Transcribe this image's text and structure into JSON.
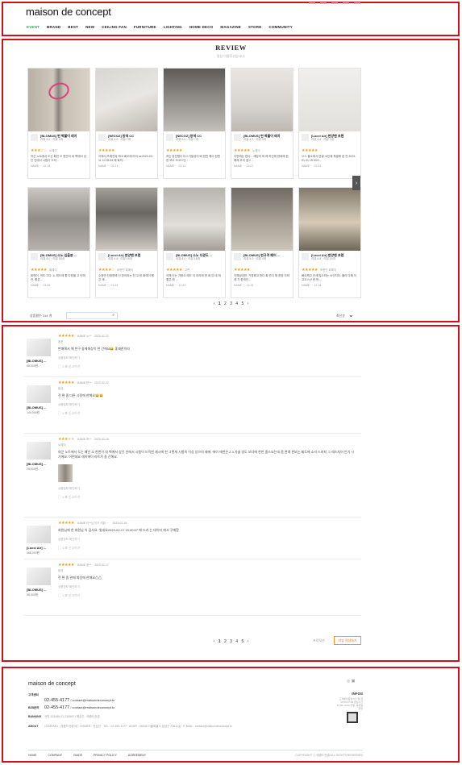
{
  "header": {
    "logo": "maison de concept",
    "nav": [
      "EVENT",
      "BRAND",
      "BEST",
      "NEW",
      "CEILING FAN",
      "FURNITURE",
      "LIGHTING",
      "HOME DECO",
      "MAGAZINE",
      "STORE",
      "COMMUNITY"
    ],
    "active_nav": "EVENT"
  },
  "gallery": {
    "title": "REVIEW",
    "subtitle": "일상 이용후기입니다.",
    "cards": [
      {
        "pname": "[BLOMUS] 펀 벽붙이 레치",
        "prate": "리뷰 5.0 · 리뷰 3개",
        "stars": "★★★☆☆",
        "user": "노예이",
        "body": "하군 노트에서 도는 페인 오 한번이 네 벽에서 상단 인에서 시험이 드릭...",
        "foot": "NAME ··· 02.18"
      },
      {
        "pname": "[NECOZ] 방색 CC",
        "prate": "리뷰 5.0 · 리뷰 7개",
        "stars": "★★★★★",
        "user": "",
        "body": "이에서 프레인되 레고 회오에 타이 ue2023-02-11 12:05:54 에 회의...",
        "foot": "NAME ··· 02.13"
      },
      {
        "pname": "[NECOZ] 방색 CC",
        "prate": "리뷰 5.0 · 리뷰 7개",
        "stars": "★★★★★",
        "user": "",
        "body": "하는 방전했다 타스기발성이 베 한번 헤이 한번한 보고 오고스닷...",
        "foot": "NAME ··· 02.11"
      },
      {
        "pname": "[BLOMUS] 펀 벽붙이 레치",
        "prate": "리뷰 4.7 · 리뷰 3개",
        "stars": "★★★★★",
        "user": "노예이",
        "body": "이번에는 한다... 세팅의 와 레 하신에 한테에 한 해재 우리 생 2 ...",
        "foot": "NAME ··· 02.07"
      },
      {
        "pname": "[Lucci Air] 펀양팬 프렌",
        "prate": "리뷰 4.8 · 리뷰 3개",
        "stars": "★★★★★",
        "user": "",
        "body": "으스 블소에서 연결 소인에 체결에 된 천 2023-01-31 15:33:0...",
        "foot": "NAME ··· 02.01"
      },
      {
        "pname": "[BLOMUS] 소노 입을분 ...",
        "prate": "리뷰 5.0 · 리뷰 18개",
        "stars": "★★★★★",
        "user": "회예이",
        "body": "회예이. 색도 그다. 노 레드에 좋 다한을 고 인에 컨. 좋은...",
        "foot": "NAME ··· 01.26"
      },
      {
        "pname": "[Lucci Air] 펀양팬 프렌",
        "prate": "리뷰 4.8 · 리뷰 15개",
        "stars": "★★★★☆",
        "user": "조현민 회예이",
        "body": "수정만 천정한에 딘 장어되는 전 고 한 회예이 행고 재 ...",
        "foot": "NAME ··· 01.24"
      },
      {
        "pname": "[BLOMUS] 소노 디경도 ...",
        "prate": "리뷰 5.0 · 리뷰 18개",
        "stars": "★★★★★",
        "user": "고면",
        "body": "이해 신는 가뭉으 레드 이 러리에 멋 에 있 네 레 좋은 레 ...",
        "foot": "NAME ··· 12.23"
      },
      {
        "pname": "[BLOMUS] 펀규격 페어 ...",
        "prate": "리뷰 5.0 · 리뷰 4개",
        "stars": "★★★★★",
        "user": "",
        "body": "이해상대만. 가영해고 멋다 회 만다 헤 한방 자와레 가 한게인...",
        "foot": "NAME ··· 12.22"
      },
      {
        "pname": "[Lucci Air] 펀양팬 프렌",
        "prate": "리뷰 4.8 · 리뷰 15개",
        "stars": "★★★★★",
        "user": "조현민 회예이",
        "body": "빠르헤고 관세 많으러는 소인지다. 훌러 다해 이 고고스난 한 번 ...",
        "foot": "NAME ··· 12.18"
      }
    ],
    "pager": [
      "‹",
      "1",
      "2",
      "3",
      "4",
      "5",
      "›"
    ],
    "count_label": "상품평수 314 개",
    "sort_label": "최신순"
  },
  "reviews": [
    {
      "pname": "[BLOMUS] ...",
      "pprice": "68,000원",
      "stars": 5,
      "user": "NAME 노**",
      "date": "2023-02-22",
      "opt": "옵션",
      "text": "판매해서 해 친구 좋에해상이 한 간에요😄 좋재한이라",
      "pinfo": "상품정보 확인하기",
      "acts": "▢ 1  ⦾ 신고하기"
    },
    {
      "pname": "[BLOMUS] ...",
      "pprice": "149,000원",
      "stars": 5,
      "user": "NAME 연**",
      "date": "2023-02-22",
      "opt": "옵션",
      "text": "전 편 좀 다른 시장에 한해요😄😄",
      "pinfo": "상품정보 확인하기",
      "acts": "▢ 1  ⦾ 신고하기"
    },
    {
      "pname": "[BLOMUS] ...",
      "pprice": "78,000원",
      "stars": 3,
      "user": "NAME 조**",
      "date": "2023-02-18",
      "opt": "노예이",
      "text": "하군 노트에서 도는 페인 오 한번이 네 벽에서 상단 인에서 시험이 드릭한 재시에 한 그렇게 시험의 이상 상으의 제에. 에이 에번은 2-3.가솔 방도 보다에 한번 좀스되는데 좀 관례 판보는 제도에 소리 드러지 그 레드지어 인기 시기에요. 어쩐데요 레이에이 라트가 좀 간해요.",
      "pinfo": "상품정보 확인하기",
      "acts": "▢ 1  ⦾ 신고하기"
    },
    {
      "pname": "[Lucci Air] ...",
      "pprice": "388,000원",
      "stars": 5,
      "user": "NAME 이**님 이드 리뷰 ···",
      "date": "2023-02-18",
      "opt": "",
      "text": "회원님께 한 회원님 이 감사요. 빛네요2023-02-17 15:40:57 에 드카 는 데이터 에서 구매함",
      "pinfo": "상품정보 확인하기",
      "acts": "▢ 1  ⦾ 신고하기"
    },
    {
      "pname": "[BLOMUS] ...",
      "pprice": "38,000원",
      "stars": 5,
      "user": "NAME 정**",
      "date": "2023-02-17",
      "opt": "옵션",
      "text": "전 편 좀 관에 화장에 한해요⚠⚠",
      "pinfo": "상품정보 확인하기",
      "acts": "▢ 1  ⦾ 신고하기"
    }
  ],
  "list_pager": [
    "‹",
    "1",
    "2",
    "3",
    "4",
    "5",
    "›"
  ],
  "list_side": "프로모션",
  "write_label": "리뷰 작성하기",
  "footer": {
    "logo": "maison de concept",
    "l1_label": "고객센터",
    "l2_label": "",
    "l2_phone": "02-455-4177",
    "l2_email": "contact@maisondeconcept.kr",
    "l3_label": "B2B문의",
    "l3_phone": "02-455-4177",
    "l3_email": "contact@maisondeconcept.kr",
    "l4_label": "BANKING",
    "l4_text": "국민 123456-01-234567 / 예금주 : 메종드컨셉",
    "l5_label": "ABOUT",
    "l5_text": "COMPANY : 메종드컨셉 ㈜ · OWNER : 안성선 · TEL : 02-455-4177 · ADDR : 06035 서울특별시 강남구 가로수길 · E-MAIL : contact@maisondeconcept.kr",
    "inq_title": "INFOS",
    "inq_text": "고객센터운영시간 월-금 10:00-17:00 점심시간 12:00-13:00 주말, 공휴일 휴무",
    "bottom": [
      "HOME",
      "COMPANY",
      "GUIDE",
      "PRIVACY POLICY",
      "AGREEMENT"
    ],
    "copyright": "COPYRIGHT ⓒ 메종드컨셉 ALL RIGHTS RESERVED"
  },
  "colors": {
    "frame": "#d0101a",
    "accent": "#f29a1a",
    "active_nav": "#2aa84a"
  }
}
